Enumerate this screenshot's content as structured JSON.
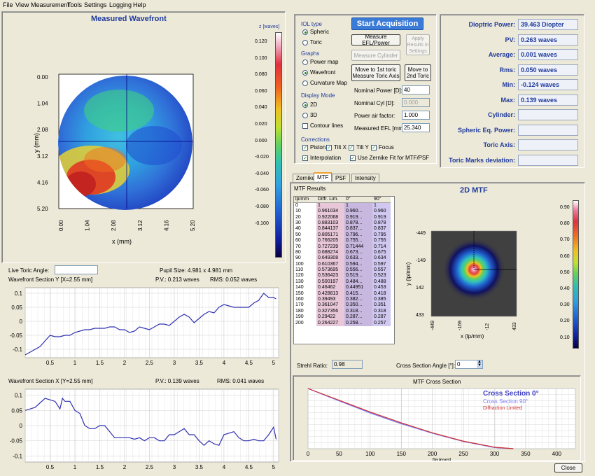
{
  "menu": [
    "File",
    "View",
    "Measurement",
    "Tools",
    "Settings",
    "Logging",
    "Help"
  ],
  "wavefront": {
    "title": "Measured Wavefront",
    "ylabel": "y (mm)",
    "xlabel": "x (mm)",
    "yticks": [
      "0.00",
      "1.04",
      "2.08",
      "3.12",
      "4.16",
      "5.20"
    ],
    "xticks": [
      "0.00",
      "1.04",
      "2.08",
      "3.12",
      "4.16",
      "5.20"
    ],
    "colorbar_title": "z [waves]",
    "colorbar_ticks": [
      "0.120",
      "0.100",
      "0.080",
      "0.060",
      "0.040",
      "0.020",
      "0.000",
      "-0.020",
      "-0.040",
      "-0.060",
      "-0.080",
      "-0.100"
    ]
  },
  "controls": {
    "iol_type": "IOL type",
    "spheric": "Spheric",
    "toric": "Toric",
    "graphs": "Graphs",
    "power_map": "Power map",
    "wavefront": "Wavefront",
    "curvature_map": "Curvature Map",
    "display_mode": "Display Mode",
    "mode_2d": "2D",
    "mode_3d": "3D",
    "contour_lines": "Contour lines",
    "start_acq": "Start Acquisition",
    "measure_efl": "Measure EFL/Power",
    "apply_results": "Apply Results in Settings",
    "measure_cyl": "Measure Cylinder",
    "move_first_toric": "Move to 1st toric Measure Toric Axis",
    "move_second_toric": "Move to 2nd Toric",
    "nominal_power_lbl": "Nominal Power [D]:",
    "nominal_power_val": "40",
    "nominal_cyl_lbl": "Nominal Cyl [D]:",
    "nominal_cyl_val": "0.000",
    "power_air_lbl": "Power air factor:",
    "power_air_val": "1.000",
    "measured_efl_lbl": "Measured EFL [mm]:",
    "measured_efl_val": "25.340",
    "corrections": "Corrections",
    "piston": "Piston",
    "tilt_x": "Tilt X",
    "tilt_y": "Tilt Y",
    "focus": "Focus",
    "interpolation": "Interpolation",
    "zernike_fit": "Use Zernike Fit for MTF/PSF"
  },
  "stats": [
    {
      "label": "Dioptric Power:",
      "value": "39.463 Diopter"
    },
    {
      "label": "PV:",
      "value": "0.263 waves"
    },
    {
      "label": "Average:",
      "value": "0.001 waves"
    },
    {
      "label": "Rms:",
      "value": "0.050 waves"
    },
    {
      "label": "Min:",
      "value": "-0.124 waves"
    },
    {
      "label": "Max:",
      "value": "0.139 waves"
    },
    {
      "label": "Cylinder:",
      "value": ""
    },
    {
      "label": "Spheric Eq. Power:",
      "value": ""
    },
    {
      "label": "Toric Axis:",
      "value": ""
    },
    {
      "label": "Toric Marks deviation:",
      "value": ""
    }
  ],
  "tabs": [
    "Zernike",
    "MTF",
    "PSF",
    "Intensity"
  ],
  "mtf_results": {
    "title": "MTF Results",
    "headers": [
      "lp/mm",
      "Diffr. Lim.",
      "0°",
      "90°"
    ],
    "rows": [
      [
        "0",
        "1",
        "1",
        "1"
      ],
      [
        "10",
        "0.961034",
        "0.960...",
        "0.960"
      ],
      [
        "20",
        "0.922068",
        "0.919...",
        "0.919"
      ],
      [
        "30",
        "0.883103",
        "0.878...",
        "0.878"
      ],
      [
        "40",
        "0.844137",
        "0.837...",
        "0.837"
      ],
      [
        "50",
        "0.805171",
        "0.796...",
        "0.795"
      ],
      [
        "60",
        "0.766205",
        "0.755...",
        "0.755"
      ],
      [
        "70",
        "0.727239",
        "0.71444",
        "0.714"
      ],
      [
        "80",
        "0.688274",
        "0.673...",
        "0.675"
      ],
      [
        "90",
        "0.649308",
        "0.633...",
        "0.634"
      ],
      [
        "100",
        "0.610367",
        "0.594...",
        "0.597"
      ],
      [
        "110",
        "0.573695",
        "0.556...",
        "0.557"
      ],
      [
        "120",
        "0.536423",
        "0.519...",
        "0.523"
      ],
      [
        "130",
        "0.500197",
        "0.484...",
        "0.488"
      ],
      [
        "140",
        "0.46462",
        "0.44951",
        "0.453"
      ],
      [
        "150",
        "0.428813",
        "0.415...",
        "0.418"
      ],
      [
        "160",
        "0.39493",
        "0.382...",
        "0.385"
      ],
      [
        "170",
        "0.361047",
        "0.350...",
        "0.351"
      ],
      [
        "180",
        "0.327356",
        "0.318...",
        "0.318"
      ],
      [
        "190",
        "0.29422",
        "0.287...",
        "0.287"
      ],
      [
        "200",
        "0.264227",
        "0.258...",
        "0.257"
      ]
    ]
  },
  "mtf2d": {
    "title": "2D MTF",
    "ylabel": "y (lp/mm)",
    "xlabel": "x (lp/mm)",
    "yticks": [
      "-449",
      "-149",
      "142",
      "433"
    ],
    "xticks": [
      "-449",
      "-169",
      "-12",
      "433"
    ],
    "colorbar_ticks": [
      "0.90",
      "0.80",
      "0.70",
      "0.60",
      "0.50",
      "0.40",
      "0.30",
      "0.20",
      "0.10"
    ]
  },
  "strehl_lbl": "Strehl Ratio:",
  "strehl_val": "0.98",
  "cross_angle_lbl": "Cross Section Angle [°]:",
  "cross_angle_val": "0",
  "live_toric_lbl": "Live Toric Angle:",
  "pupil_size": "Pupil Size: 4.981 x 4.981 mm",
  "close": "Close",
  "chart_data": [
    {
      "type": "line",
      "title": "Wavefront Section Y [X=2.55 mm]",
      "pv": "P.V.: 0.213 waves",
      "rms": "RMS: 0.052 waves",
      "x": [
        0,
        0.1,
        0.2,
        0.3,
        0.4,
        0.5,
        0.6,
        0.7,
        0.8,
        0.9,
        1.0,
        1.1,
        1.2,
        1.3,
        1.4,
        1.5,
        1.6,
        1.7,
        1.8,
        1.9,
        2.0,
        2.1,
        2.2,
        2.3,
        2.4,
        2.5,
        2.6,
        2.7,
        2.8,
        2.9,
        3.0,
        3.1,
        3.2,
        3.3,
        3.4,
        3.5,
        3.6,
        3.7,
        3.8,
        3.9,
        4.0,
        4.1,
        4.2,
        4.3,
        4.4,
        4.5,
        4.6,
        4.7,
        4.8,
        4.9,
        5.0,
        5.05
      ],
      "y": [
        -0.12,
        -0.11,
        -0.1,
        -0.09,
        -0.07,
        -0.05,
        -0.055,
        -0.055,
        -0.05,
        -0.05,
        -0.04,
        -0.035,
        -0.03,
        -0.03,
        -0.025,
        -0.025,
        -0.025,
        -0.02,
        -0.02,
        -0.03,
        -0.03,
        -0.04,
        -0.035,
        -0.02,
        -0.025,
        -0.03,
        -0.02,
        -0.01,
        -0.01,
        -0.015,
        0.0,
        0.015,
        0.025,
        0.015,
        -0.005,
        0.01,
        0.025,
        0.035,
        0.03,
        0.05,
        0.06,
        0.055,
        0.05,
        0.05,
        0.05,
        0.05,
        0.065,
        0.075,
        0.1,
        0.085,
        0.085,
        0.08
      ],
      "xticks": [
        0.5,
        1,
        1.5,
        2,
        2.5,
        3,
        3.5,
        4,
        4.5,
        5
      ],
      "yticks": [
        0.1,
        0.05,
        0,
        -0.05,
        -0.1
      ],
      "xlim": [
        0,
        5.1
      ],
      "ylim": [
        -0.13,
        0.12
      ]
    },
    {
      "type": "line",
      "title": "Wavefront Section X [Y=2.55 mm]",
      "pv": "P.V.: 0.139 waves",
      "rms": "RMS: 0.041 waves",
      "x": [
        0,
        0.1,
        0.2,
        0.3,
        0.4,
        0.5,
        0.6,
        0.7,
        0.75,
        0.8,
        0.9,
        1.0,
        1.1,
        1.2,
        1.3,
        1.4,
        1.5,
        1.6,
        1.7,
        1.8,
        1.9,
        2.0,
        2.1,
        2.2,
        2.3,
        2.4,
        2.5,
        2.6,
        2.7,
        2.8,
        2.9,
        3.0,
        3.1,
        3.2,
        3.3,
        3.4,
        3.5,
        3.6,
        3.7,
        3.8,
        3.9,
        4.0,
        4.1,
        4.2,
        4.3,
        4.4,
        4.5,
        4.6,
        4.7,
        4.8,
        4.9,
        5.0,
        5.05
      ],
      "y": [
        0.05,
        0.055,
        0.06,
        0.075,
        0.09,
        0.085,
        0.08,
        0.055,
        0.09,
        0.08,
        0.08,
        0.05,
        0.04,
        0.0,
        -0.01,
        -0.01,
        0.0,
        0.0,
        -0.02,
        -0.04,
        -0.04,
        -0.04,
        -0.04,
        -0.045,
        -0.04,
        -0.05,
        -0.04,
        -0.04,
        -0.05,
        -0.05,
        -0.03,
        -0.03,
        -0.02,
        -0.01,
        -0.03,
        -0.03,
        -0.05,
        -0.065,
        -0.05,
        -0.06,
        -0.065,
        -0.03,
        -0.025,
        -0.02,
        -0.04,
        -0.05,
        -0.05,
        -0.045,
        -0.05,
        -0.05,
        -0.03,
        -0.005,
        -0.045
      ],
      "xticks": [
        0.5,
        1,
        1.5,
        2,
        2.5,
        3,
        3.5,
        4,
        4.5,
        5
      ],
      "yticks": [
        0.1,
        0.05,
        0,
        -0.05,
        -0.1
      ],
      "xlim": [
        0,
        5.1
      ],
      "ylim": [
        -0.12,
        0.12
      ]
    },
    {
      "type": "line",
      "title": "MTF Cross Section",
      "xlabel": "[lp/mm]",
      "legend": [
        "Cross Section 0°",
        "Cross Section 90°",
        "Diffraction Limited"
      ],
      "series": [
        {
          "name": "Cross Section 0°",
          "color": "#4040c0",
          "x": [
            0,
            50,
            100,
            150,
            200,
            250,
            300,
            330
          ],
          "y": [
            1.0,
            0.796,
            0.594,
            0.415,
            0.258,
            0.12,
            0.02,
            0.0
          ]
        },
        {
          "name": "Cross Section 90°",
          "color": "#8080ff",
          "x": [
            0,
            50,
            100,
            150,
            200,
            250,
            300,
            330
          ],
          "y": [
            1.0,
            0.795,
            0.597,
            0.418,
            0.257,
            0.12,
            0.02,
            0.0
          ]
        },
        {
          "name": "Diffraction Limited",
          "color": "#d03030",
          "x": [
            0,
            50,
            100,
            150,
            200,
            250,
            300,
            330
          ],
          "y": [
            1.0,
            0.805,
            0.61,
            0.429,
            0.264,
            0.125,
            0.025,
            0.0
          ]
        }
      ],
      "xticks": [
        0,
        50,
        100,
        150,
        200,
        250,
        300,
        350,
        400
      ],
      "xlim": [
        0,
        430
      ],
      "ylim": [
        0,
        1
      ]
    }
  ]
}
